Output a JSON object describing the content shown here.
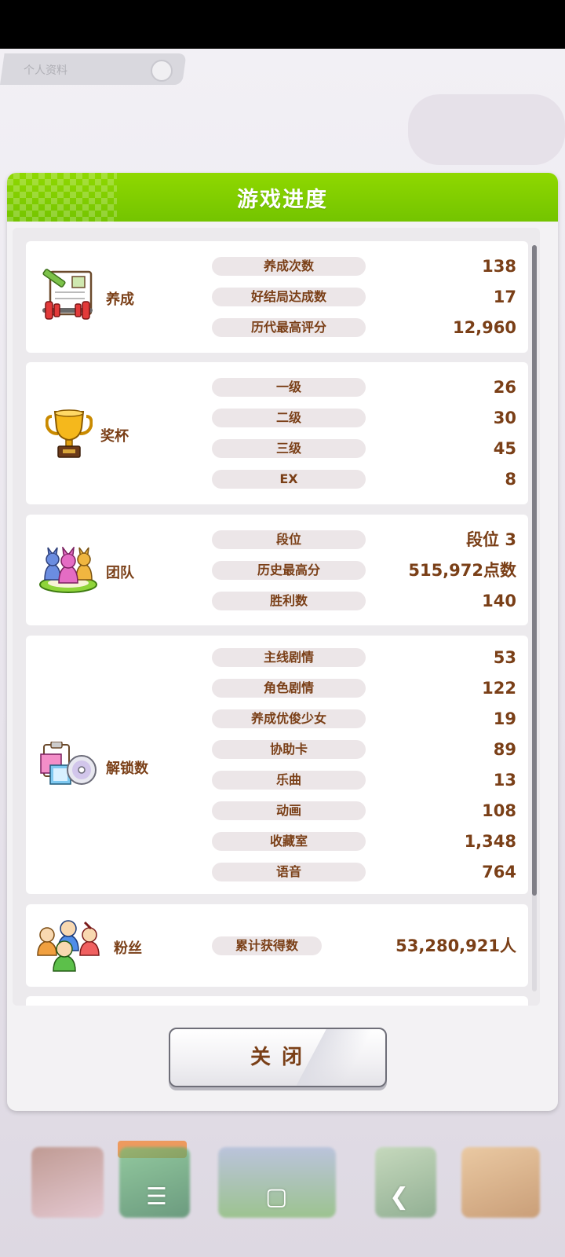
{
  "status_bar": {},
  "top_chip": {
    "label": "个人资料"
  },
  "dialog": {
    "title": "游戏进度",
    "sections": {
      "training": {
        "label": "养成",
        "rows": [
          {
            "label": "养成次数",
            "value": "138"
          },
          {
            "label": "好结局达成数",
            "value": "17"
          },
          {
            "label": "历代最高评分",
            "value": "12,960"
          }
        ]
      },
      "trophy": {
        "label": "奖杯",
        "rows": [
          {
            "label": "一级",
            "value": "26"
          },
          {
            "label": "二级",
            "value": "30"
          },
          {
            "label": "三级",
            "value": "45"
          },
          {
            "label": "EX",
            "value": "8"
          }
        ]
      },
      "team": {
        "label": "团队",
        "rows": [
          {
            "label": "段位",
            "value": "段位 3"
          },
          {
            "label": "历史最高分",
            "value": "515,972点数"
          },
          {
            "label": "胜利数",
            "value": "140"
          }
        ]
      },
      "unlock": {
        "label": "解锁数",
        "rows": [
          {
            "label": "主线剧情",
            "value": "53"
          },
          {
            "label": "角色剧情",
            "value": "122"
          },
          {
            "label": "养成优俊少女",
            "value": "19"
          },
          {
            "label": "协助卡",
            "value": "89"
          },
          {
            "label": "乐曲",
            "value": "13"
          },
          {
            "label": "动画",
            "value": "108"
          },
          {
            "label": "收藏室",
            "value": "1,348"
          },
          {
            "label": "语音",
            "value": "764"
          }
        ]
      },
      "fans": {
        "label": "粉丝",
        "rows": [
          {
            "label": "累计获得数",
            "value": "53,280,921人"
          }
        ]
      }
    },
    "close_label": "关闭"
  },
  "colors": {
    "header_green": "#7ccc00",
    "text_brown": "#7a3f17",
    "pill_bg": "#ece6e8"
  },
  "icons": {
    "training": "training-notebook-dumbbell-icon",
    "trophy": "gold-trophy-icon",
    "team": "team-figures-icon",
    "unlock": "collection-cards-disc-icon",
    "fans": "fans-crowd-icon"
  },
  "system_nav": {
    "menu": "menu-icon",
    "home": "home-icon",
    "back": "back-icon"
  }
}
